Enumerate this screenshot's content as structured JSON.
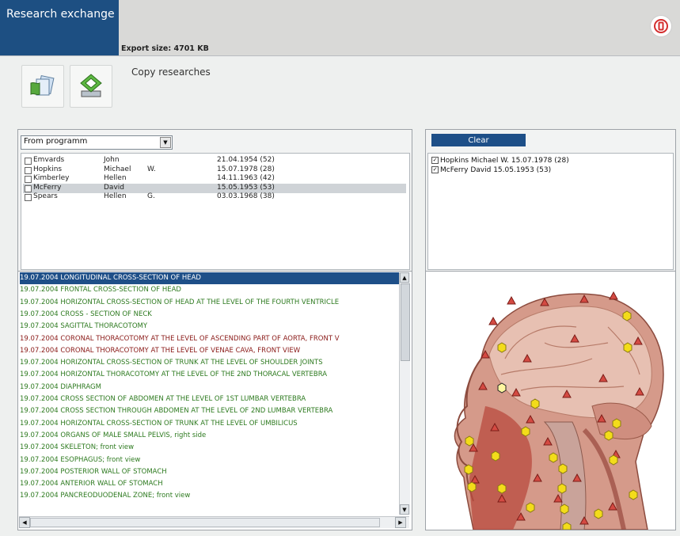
{
  "app": {
    "tab_title": "Research exchange",
    "export_size": "Export size: 4701 KB"
  },
  "toolbar": {
    "copy_label": "Copy researches",
    "tool1_icon": "copy-researches-icon",
    "tool2_icon": "export-disk-icon"
  },
  "source": {
    "selected": "From programm"
  },
  "patients": [
    {
      "last": "Emvards",
      "first": "John",
      "middle": "",
      "date": "21.04.1954 (52)",
      "checked": false
    },
    {
      "last": "Hopkins",
      "first": "Michael",
      "middle": "W.",
      "date": "15.07.1978 (28)",
      "checked": false
    },
    {
      "last": "Kimberley",
      "first": "Hellen",
      "middle": "",
      "date": "14.11.1963 (42)",
      "checked": false
    },
    {
      "last": "McFerry",
      "first": "David",
      "middle": "",
      "date": "15.05.1953 (53)",
      "checked": false
    },
    {
      "last": "Spears",
      "first": "Hellen",
      "middle": "G.",
      "date": "03.03.1968 (38)",
      "checked": false
    }
  ],
  "researches": [
    {
      "text": "19.07.2004  LONGITUDINAL CROSS-SECTION OF HEAD",
      "color": "green",
      "highlight": true
    },
    {
      "text": "19.07.2004  FRONTAL CROSS-SECTION OF HEAD",
      "color": "green"
    },
    {
      "text": "19.07.2004  HORIZONTAL CROSS-SECTION OF HEAD AT THE LEVEL OF THE FOURTH VENTRICLE",
      "color": "green"
    },
    {
      "text": "19.07.2004  CROSS - SECTION  OF  NECK",
      "color": "green"
    },
    {
      "text": "19.07.2004  SAGITTAL THORACOTOMY",
      "color": "green"
    },
    {
      "text": "19.07.2004  CORONAL THORACOTOMY AT THE LEVEL OF ASCENDING PART OF AORTA, FRONT V",
      "color": "red"
    },
    {
      "text": "19.07.2004  CORONAL THORACOTOMY AT THE LEVEL OF VENAE CAVA, FRONT VIEW",
      "color": "red"
    },
    {
      "text": "19.07.2004  HORIZONTAL CROSS-SECTION OF TRUNK AT THE LEVEL OF SHOULDER JOINTS",
      "color": "green"
    },
    {
      "text": "19.07.2004  HORIZONTAL THORACOTOMY AT THE LEVEL OF THE 2ND THORACAL VERTEBRA",
      "color": "green"
    },
    {
      "text": "19.07.2004  DIAPHRAGM",
      "color": "green"
    },
    {
      "text": "19.07.2004  CROSS SECTION OF ABDOMEN AT THE LEVEL OF 1ST LUMBAR VERTEBRA",
      "color": "green"
    },
    {
      "text": "19.07.2004  CROSS SECTION THROUGH ABDOMEN AT THE LEVEL OF 2ND LUMBAR VERTEBRA",
      "color": "green"
    },
    {
      "text": "19.07.2004  HORIZONTAL CROSS-SECTION OF TRUNK AT THE LEVEL OF UMBILICUS",
      "color": "green"
    },
    {
      "text": "19.07.2004  ORGANS OF MALE SMALL PELVIS, right side",
      "color": "green"
    },
    {
      "text": "19.07.2004  SKELETON; front view",
      "color": "green"
    },
    {
      "text": "19.07.2004  ESOPHAGUS; front view",
      "color": "green"
    },
    {
      "text": "19.07.2004  POSTERIOR WALL OF STOMACH",
      "color": "green"
    },
    {
      "text": "19.07.2004  ANTERIOR  WALL  OF  STOMACH",
      "color": "green"
    },
    {
      "text": "19.07.2004  PANCREODUODENAL ZONE; front view",
      "color": "green"
    }
  ],
  "selection": {
    "clear_label": "Clear",
    "items": [
      {
        "text": "Hopkins Michael W.   15.07.1978 (28)",
        "checked": true
      },
      {
        "text": "McFerry David    15.05.1953 (53)",
        "checked": true
      }
    ]
  },
  "preview": {
    "image_icon": "head-cross-section-image"
  },
  "colors": {
    "accent": "#1e4f88",
    "tab": "#1d4f82",
    "green_text": "#2d7a1f",
    "red_text": "#8a1a18",
    "marker_triangle": "#c8443c",
    "marker_hexagon": "#f3dc1a"
  }
}
